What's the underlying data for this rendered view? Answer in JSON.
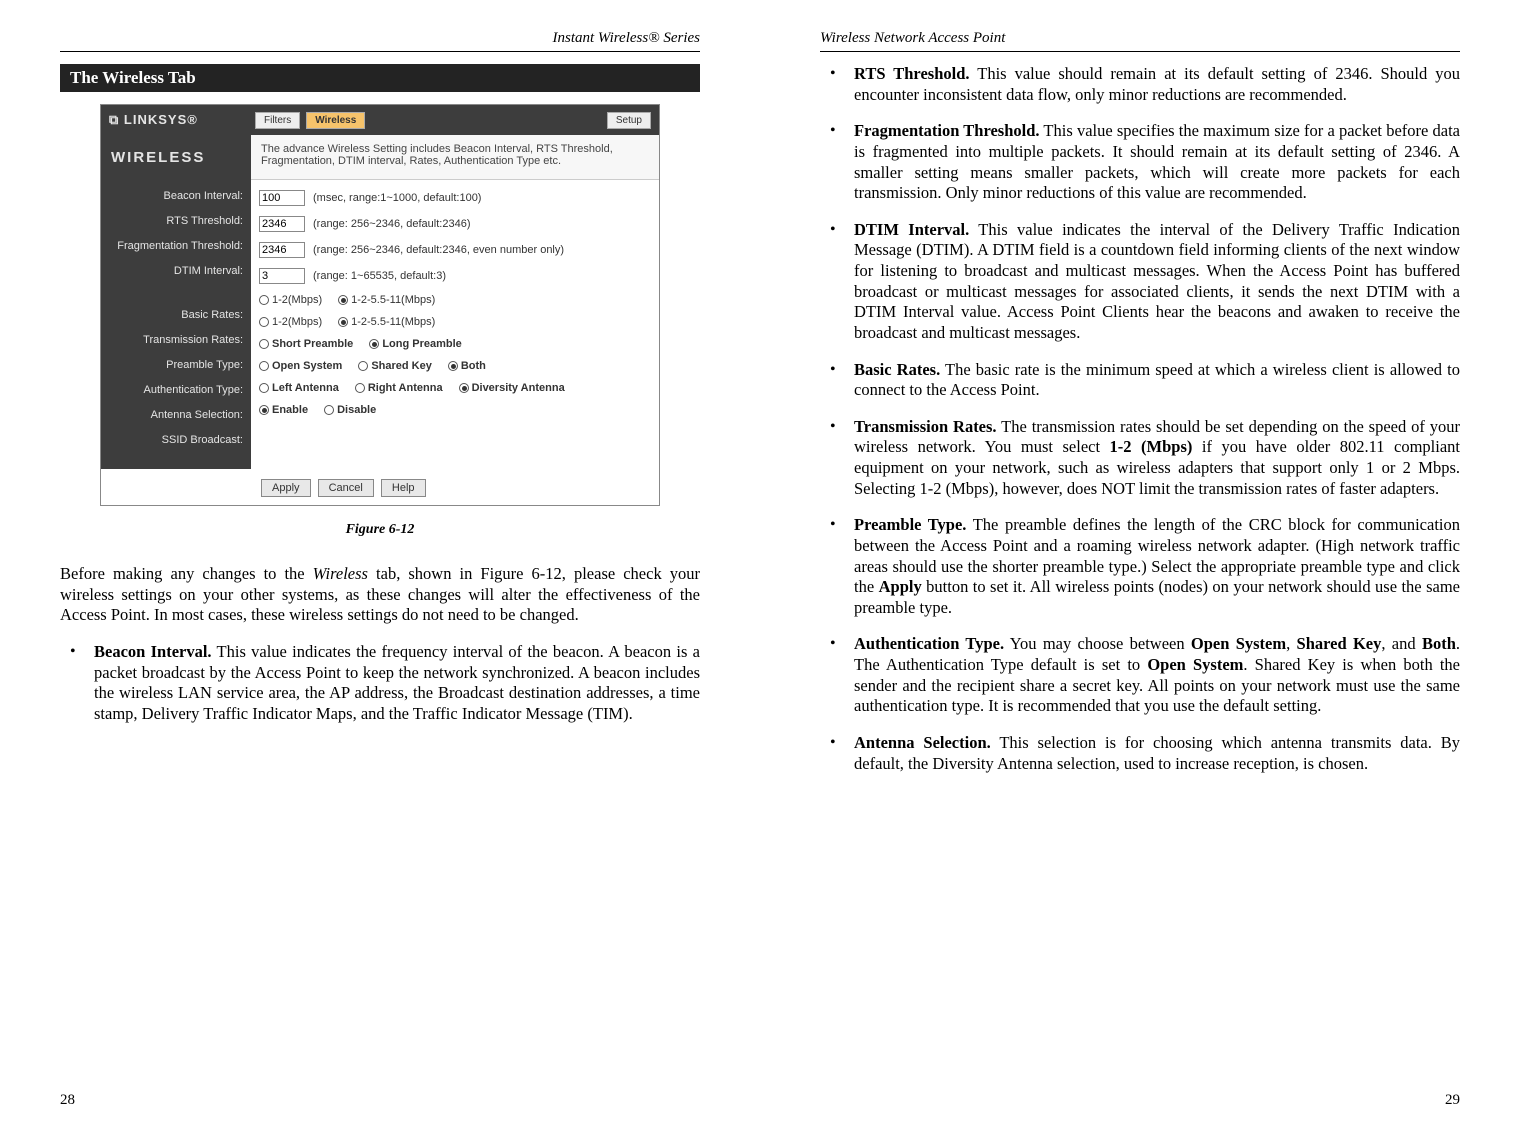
{
  "left": {
    "header": "Instant Wireless® Series",
    "section_title": "The Wireless Tab",
    "page_num": "28"
  },
  "right": {
    "header": "Wireless Network Access Point",
    "page_num": "29"
  },
  "screenshot": {
    "logo": "⧉ LINKSYS®",
    "tabs": [
      "Filters",
      "Wireless"
    ],
    "setup_btn": "Setup",
    "sidebar_title": "WIRELESS",
    "desc": "The advance Wireless Setting includes Beacon Interval, RTS Threshold, Fragmentation, DTIM interval, Rates, Authentication Type etc.",
    "labels": {
      "beacon": "Beacon Interval:",
      "rts": "RTS Threshold:",
      "frag": "Fragmentation Threshold:",
      "dtim": "DTIM Interval:",
      "basic": "Basic Rates:",
      "trans": "Transmission Rates:",
      "preamble": "Preamble Type:",
      "auth": "Authentication Type:",
      "antenna": "Antenna Selection:",
      "ssid": "SSID Broadcast:"
    },
    "fields": {
      "beacon_val": "100",
      "beacon_hint": "(msec, range:1~1000, default:100)",
      "rts_val": "2346",
      "rts_hint": "(range: 256~2346, default:2346)",
      "frag_val": "2346",
      "frag_hint": "(range: 256~2346, default:2346, even number only)",
      "dtim_val": "3",
      "dtim_hint": "(range: 1~65535, default:3)",
      "rate_opt1": "1-2(Mbps)",
      "rate_opt2": "1-2-5.5-11(Mbps)",
      "preamble_opt1": "Short Preamble",
      "preamble_opt2": "Long Preamble",
      "auth_opt1": "Open System",
      "auth_opt2": "Shared Key",
      "auth_opt3": "Both",
      "ant_opt1": "Left Antenna",
      "ant_opt2": "Right Antenna",
      "ant_opt3": "Diversity Antenna",
      "ssid_opt1": "Enable",
      "ssid_opt2": "Disable"
    },
    "buttons": {
      "apply": "Apply",
      "cancel": "Cancel",
      "help": "Help"
    }
  },
  "figure_caption": "Figure 6-12",
  "intro_para_pre": "Before making any changes to the ",
  "intro_para_italic": "Wireless",
  "intro_para_post": " tab, shown in Figure 6-12, please check your wireless settings on your other systems, as these changes will alter the effectiveness of the Access Point. In most cases, these wireless settings do not need to be changed.",
  "bullets_left": [
    {
      "title": "Beacon Interval.",
      "text": "  This value indicates the frequency interval of the beacon. A beacon is a packet broadcast by the Access Point to keep the network synchronized. A beacon includes the wireless LAN service area, the AP address, the Broadcast destination addresses, a time stamp, Delivery Traffic Indicator Maps, and the Traffic Indicator Message (TIM)."
    }
  ],
  "bullets_right": [
    {
      "title": "RTS Threshold.",
      "text": "  This value should remain at its default setting of 2346. Should you encounter inconsistent data flow, only minor reductions are recommended."
    },
    {
      "title": "Fragmentation Threshold.",
      "text": "  This value specifies the maximum size for a packet before data is fragmented into multiple packets. It should remain at its default setting of 2346. A smaller setting means smaller packets, which will create more packets for each transmission. Only minor reductions of this value are recommended."
    },
    {
      "title": "DTIM Interval.",
      "text": "  This value indicates the interval of the Delivery Traffic Indication Message (DTIM). A DTIM field is a countdown field informing clients of the next window for listening to broadcast and multicast messages. When the Access Point has buffered broadcast or multicast messages for associated clients, it sends the next DTIM with a DTIM Interval value. Access Point Clients hear the beacons and awaken to receive the broadcast and multicast messages."
    },
    {
      "title": "Basic Rates.",
      "text": " The basic rate is the minimum speed at which a wireless client is allowed to connect to the Access Point."
    }
  ],
  "trans_title": "Transmission Rates.",
  "trans_pre": " The transmission rates should be set depending on the speed of your wireless network. You must select ",
  "trans_bold": "1-2 (Mbps)",
  "trans_post": " if you have older 802.11 compliant equipment on your network, such as wireless adapters that support only 1 or 2 Mbps. Selecting 1-2 (Mbps), however, does NOT limit the transmission rates of faster adapters.",
  "preamble_title": "Preamble Type.",
  "preamble_pre": " The preamble defines the length of the CRC block for communication between the Access Point and a roaming wireless network adapter. (High network traffic areas should use the shorter preamble type.) Select the appropriate preamble type and click the ",
  "preamble_bold": "Apply",
  "preamble_post": " button to set it. All wireless points (nodes) on your network should use the same preamble type.",
  "auth_title": "Authentication Type.",
  "auth_pre": " You may choose between ",
  "auth_b1": "Open System",
  "auth_mid1": ", ",
  "auth_b2": "Shared Key",
  "auth_mid2": ", and ",
  "auth_b3": "Both",
  "auth_mid3": ".  The Authentication Type default is set to ",
  "auth_b4": "Open System",
  "auth_post": ". Shared Key is when both the sender and the recipient share a secret key. All points on your network must use the same authentication type. It is recommended that you use the default setting.",
  "antenna_title": "Antenna Selection.",
  "antenna_text": "  This selection is for choosing which antenna transmits data. By default, the Diversity Antenna selection, used to increase reception, is chosen."
}
